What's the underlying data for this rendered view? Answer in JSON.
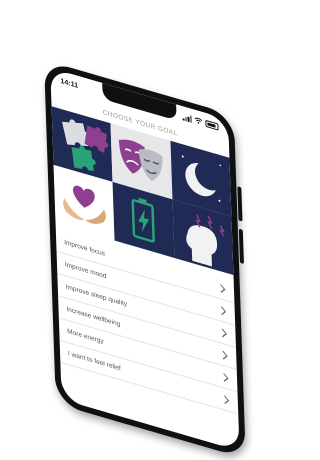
{
  "status_bar": {
    "time": "14:11"
  },
  "header": {
    "title": "CHOOSE YOUR GOAL"
  },
  "tiles": [
    {
      "icon": "puzzle-pieces-icon"
    },
    {
      "icon": "theater-masks-icon"
    },
    {
      "icon": "moon-icon"
    },
    {
      "icon": "heart-hands-icon"
    },
    {
      "icon": "battery-charging-icon"
    },
    {
      "icon": "head-stress-icon"
    }
  ],
  "goals": [
    {
      "label": "Improve focus"
    },
    {
      "label": "Improve mood"
    },
    {
      "label": "Improve sleep quality"
    },
    {
      "label": "Increase wellbeing"
    },
    {
      "label": "More energy"
    },
    {
      "label": "I want to feel relief"
    }
  ],
  "colors": {
    "navy": "#1f2a55",
    "purple": "#8e3f8f",
    "green": "#2aa37a",
    "white": "#ffffff"
  }
}
